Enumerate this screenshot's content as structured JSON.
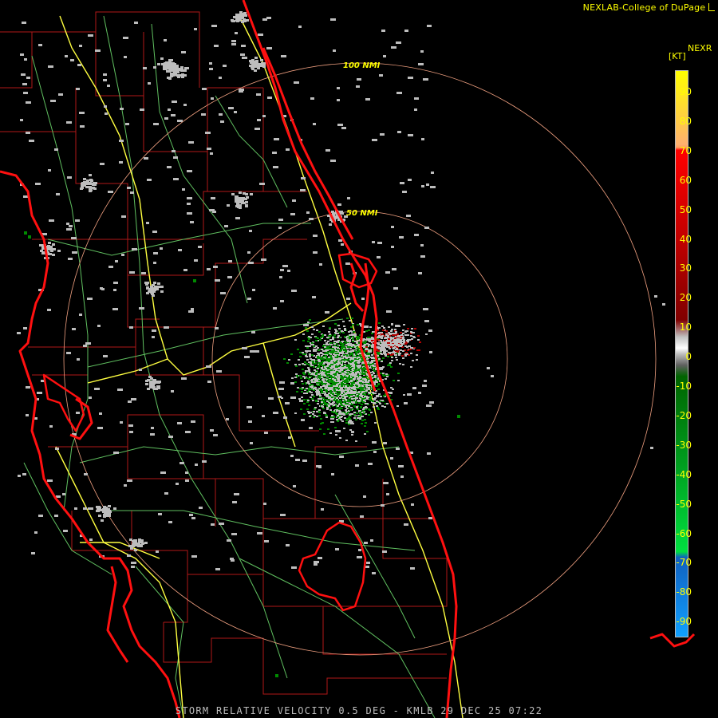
{
  "credit": "NEXLAB-College of DuPage",
  "credit_icon": "chart-icon",
  "legend": {
    "product": "NEXR",
    "unit": "[KT]",
    "ticks": [
      "90",
      "80",
      "70",
      "60",
      "50",
      "40",
      "30",
      "20",
      "10",
      "0",
      "-10",
      "-20",
      "-30",
      "-40",
      "-50",
      "-60",
      "-70",
      "-80",
      "-90"
    ],
    "colors": {
      "top": "#ffff00",
      "orange": "#ffa060",
      "red": "#ff0000",
      "dark_red": "#800000",
      "zero": "#c0c0c0",
      "dark_green": "#006400",
      "green": "#00e040",
      "blue": "#1060c0",
      "cyan": "#10a0ff"
    }
  },
  "rings": {
    "r100": "100 NMI",
    "r50": "50 NMI"
  },
  "footer": "STORM RELATIVE VELOCITY 0.5 DEG - KMLB 29 DEC 25 07:22",
  "colors": {
    "coast": "#ff1010",
    "county": "#b01818",
    "highway_major": "#ffff40",
    "highway_minor": "#60c060",
    "range_ring": "#f0a080",
    "echo_gray": "#bdbdbd",
    "echo_green": "#008a00",
    "echo_red": "#b00000"
  }
}
